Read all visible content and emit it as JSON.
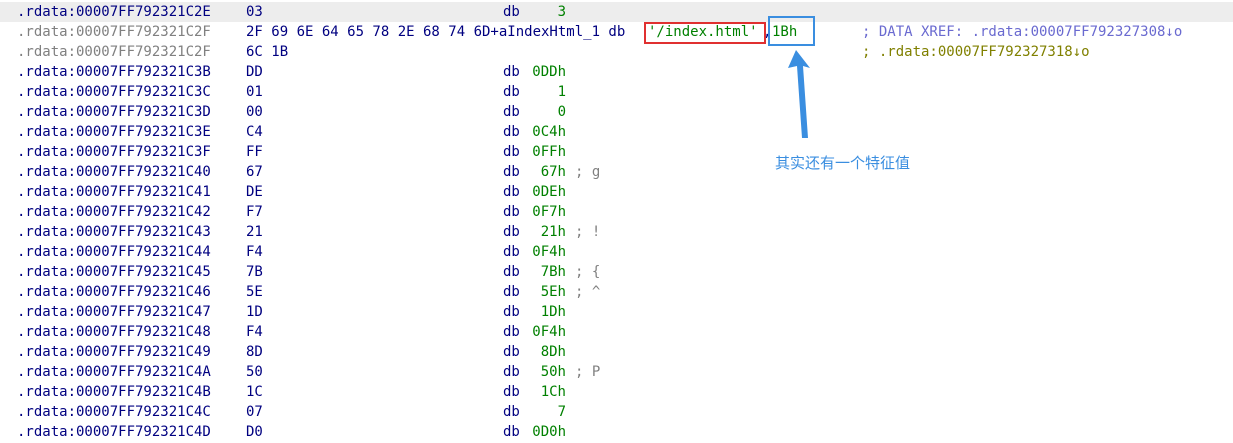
{
  "rows": [
    {
      "addr": ".rdata:00007FF792321C2E",
      "hex": "03",
      "mnem": "db",
      "val": "3",
      "cmt": ""
    },
    {
      "addr": ".rdata:00007FF792321C2F",
      "hex": "2F 69 6E 64 65 78 2E 68 74 6D+aIndexHtml_1 db",
      "str": "'/index.html'",
      "sep": ",",
      "val": "1Bh",
      "xref": "; DATA XREF: .rdata:00007FF792327308↓o"
    },
    {
      "addr": ".rdata:00007FF792321C2F",
      "hex": "6C 1B",
      "xref": "; .rdata:00007FF792327318↓o"
    },
    {
      "addr": ".rdata:00007FF792321C3B",
      "hex": "DD",
      "mnem": "db",
      "val": "0DDh",
      "cmt": ""
    },
    {
      "addr": ".rdata:00007FF792321C3C",
      "hex": "01",
      "mnem": "db",
      "val": "1",
      "cmt": ""
    },
    {
      "addr": ".rdata:00007FF792321C3D",
      "hex": "00",
      "mnem": "db",
      "val": "0",
      "cmt": ""
    },
    {
      "addr": ".rdata:00007FF792321C3E",
      "hex": "C4",
      "mnem": "db",
      "val": "0C4h",
      "cmt": ""
    },
    {
      "addr": ".rdata:00007FF792321C3F",
      "hex": "FF",
      "mnem": "db",
      "val": "0FFh",
      "cmt": ""
    },
    {
      "addr": ".rdata:00007FF792321C40",
      "hex": "67",
      "mnem": "db",
      "val": "67h",
      "cmt": "; g"
    },
    {
      "addr": ".rdata:00007FF792321C41",
      "hex": "DE",
      "mnem": "db",
      "val": "0DEh",
      "cmt": ""
    },
    {
      "addr": ".rdata:00007FF792321C42",
      "hex": "F7",
      "mnem": "db",
      "val": "0F7h",
      "cmt": ""
    },
    {
      "addr": ".rdata:00007FF792321C43",
      "hex": "21",
      "mnem": "db",
      "val": "21h",
      "cmt": "; !"
    },
    {
      "addr": ".rdata:00007FF792321C44",
      "hex": "F4",
      "mnem": "db",
      "val": "0F4h",
      "cmt": ""
    },
    {
      "addr": ".rdata:00007FF792321C45",
      "hex": "7B",
      "mnem": "db",
      "val": "7Bh",
      "cmt": "; {"
    },
    {
      "addr": ".rdata:00007FF792321C46",
      "hex": "5E",
      "mnem": "db",
      "val": "5Eh",
      "cmt": "; ^"
    },
    {
      "addr": ".rdata:00007FF792321C47",
      "hex": "1D",
      "mnem": "db",
      "val": "1Dh",
      "cmt": ""
    },
    {
      "addr": ".rdata:00007FF792321C48",
      "hex": "F4",
      "mnem": "db",
      "val": "0F4h",
      "cmt": ""
    },
    {
      "addr": ".rdata:00007FF792321C49",
      "hex": "8D",
      "mnem": "db",
      "val": "8Dh",
      "cmt": ""
    },
    {
      "addr": ".rdata:00007FF792321C4A",
      "hex": "50",
      "mnem": "db",
      "val": "50h",
      "cmt": "; P"
    },
    {
      "addr": ".rdata:00007FF792321C4B",
      "hex": "1C",
      "mnem": "db",
      "val": "1Ch",
      "cmt": ""
    },
    {
      "addr": ".rdata:00007FF792321C4C",
      "hex": "07",
      "mnem": "db",
      "val": "7",
      "cmt": ""
    },
    {
      "addr": ".rdata:00007FF792321C4D",
      "hex": "D0",
      "mnem": "db",
      "val": "0D0h",
      "cmt": ""
    }
  ],
  "annotation": {
    "note": "其实还有一个特征值",
    "red_color": "#e03030",
    "blue_color": "#3a8ee0"
  }
}
